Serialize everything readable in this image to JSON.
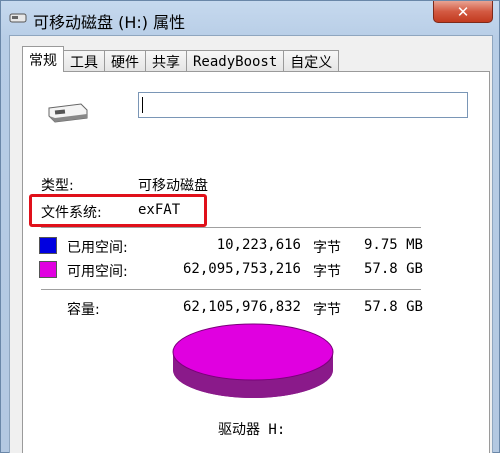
{
  "window": {
    "title": "可移动磁盘 (H:) 属性",
    "close_label": "✕"
  },
  "tabs": [
    {
      "label": "常规"
    },
    {
      "label": "工具"
    },
    {
      "label": "硬件"
    },
    {
      "label": "共享"
    },
    {
      "label": "ReadyBoost"
    },
    {
      "label": "自定义"
    }
  ],
  "active_tab": "常规",
  "name_input": {
    "value": ""
  },
  "type": {
    "label": "类型:",
    "value": "可移动磁盘"
  },
  "filesystem": {
    "label": "文件系统:",
    "value": "exFAT"
  },
  "used": {
    "label": "已用空间:",
    "bytes": "10,223,616",
    "unit": "字节",
    "size": "9.75 MB",
    "color": "#0000e0"
  },
  "free": {
    "label": "可用空间:",
    "bytes": "62,095,753,216",
    "unit": "字节",
    "size": "57.8 GB",
    "color": "#e000e0"
  },
  "capacity": {
    "label": "容量:",
    "bytes": "62,105,976,832",
    "unit": "字节",
    "size": "57.8 GB"
  },
  "drive_caption": "驱动器 H:",
  "colors": {
    "highlight": "#e0101a",
    "pie_top": "#e000e0",
    "pie_side": "#8a1a8a"
  }
}
